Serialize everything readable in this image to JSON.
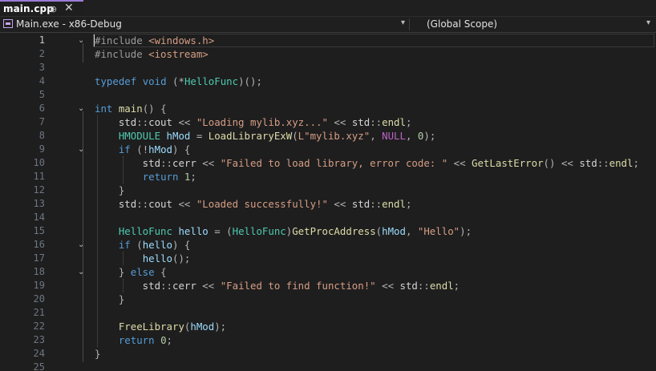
{
  "tab": {
    "title": "main.cpp",
    "pin_glyph": "⊕",
    "close_glyph": "✕"
  },
  "navbar": {
    "project": "Main.exe - x86-Debug",
    "scope": "(Global Scope)",
    "dropdown_glyph": "▾"
  },
  "editor": {
    "active_line": 1,
    "fold_glyph": "⌄",
    "lines": [
      {
        "n": "1",
        "fold": true,
        "tokens": [
          [
            "pp",
            "#include "
          ],
          [
            "st",
            "<windows.h>"
          ]
        ]
      },
      {
        "n": "2",
        "tokens": [
          [
            "pp",
            "#include "
          ],
          [
            "st",
            "<iostream>"
          ]
        ]
      },
      {
        "n": "3",
        "tokens": []
      },
      {
        "n": "4",
        "tokens": [
          [
            "kw",
            "typedef "
          ],
          [
            "kw",
            "void "
          ],
          [
            "op",
            "("
          ],
          [
            "op",
            "*"
          ],
          [
            "ty",
            "HelloFunc"
          ],
          [
            "op",
            ")();"
          ]
        ]
      },
      {
        "n": "5",
        "tokens": []
      },
      {
        "n": "6",
        "fold": true,
        "tokens": [
          [
            "kw",
            "int "
          ],
          [
            "fn",
            "main"
          ],
          [
            "op",
            "() {"
          ]
        ]
      },
      {
        "n": "7",
        "tokens": [
          [
            "pl",
            "    std"
          ],
          [
            "op",
            "::"
          ],
          [
            "pl",
            "cout "
          ],
          [
            "op",
            "<< "
          ],
          [
            "st",
            "\"Loading mylib.xyz...\" "
          ],
          [
            "op",
            "<< "
          ],
          [
            "pl",
            "std"
          ],
          [
            "op",
            "::"
          ],
          [
            "fn",
            "endl"
          ],
          [
            "op",
            ";"
          ]
        ]
      },
      {
        "n": "8",
        "tokens": [
          [
            "pl",
            "    "
          ],
          [
            "ty",
            "HMODULE "
          ],
          [
            "va",
            "hMod "
          ],
          [
            "op",
            "= "
          ],
          [
            "fn",
            "LoadLibraryExW"
          ],
          [
            "op",
            "("
          ],
          [
            "st",
            "L\"mylib.xyz\""
          ],
          [
            "op",
            ", "
          ],
          [
            "mc",
            "NULL"
          ],
          [
            "op",
            ", "
          ],
          [
            "nm",
            "0"
          ],
          [
            "op",
            ");"
          ]
        ]
      },
      {
        "n": "9",
        "fold": true,
        "tokens": [
          [
            "pl",
            "    "
          ],
          [
            "kw",
            "if "
          ],
          [
            "op",
            "(!"
          ],
          [
            "va",
            "hMod"
          ],
          [
            "op",
            ") {"
          ]
        ]
      },
      {
        "n": "10",
        "tokens": [
          [
            "pl",
            "        std"
          ],
          [
            "op",
            "::"
          ],
          [
            "pl",
            "cerr "
          ],
          [
            "op",
            "<< "
          ],
          [
            "st",
            "\"Failed to load library, error code: \" "
          ],
          [
            "op",
            "<< "
          ],
          [
            "fn",
            "GetLastError"
          ],
          [
            "op",
            "() << "
          ],
          [
            "pl",
            "std"
          ],
          [
            "op",
            "::"
          ],
          [
            "fn",
            "endl"
          ],
          [
            "op",
            ";"
          ]
        ]
      },
      {
        "n": "11",
        "tokens": [
          [
            "pl",
            "        "
          ],
          [
            "kw",
            "return "
          ],
          [
            "nm",
            "1"
          ],
          [
            "op",
            ";"
          ]
        ]
      },
      {
        "n": "12",
        "tokens": [
          [
            "op",
            "    }"
          ]
        ]
      },
      {
        "n": "13",
        "tokens": [
          [
            "pl",
            "    std"
          ],
          [
            "op",
            "::"
          ],
          [
            "pl",
            "cout "
          ],
          [
            "op",
            "<< "
          ],
          [
            "st",
            "\"Loaded successfully!\" "
          ],
          [
            "op",
            "<< "
          ],
          [
            "pl",
            "std"
          ],
          [
            "op",
            "::"
          ],
          [
            "fn",
            "endl"
          ],
          [
            "op",
            ";"
          ]
        ]
      },
      {
        "n": "14",
        "tokens": []
      },
      {
        "n": "15",
        "tokens": [
          [
            "pl",
            "    "
          ],
          [
            "ty",
            "HelloFunc "
          ],
          [
            "va",
            "hello "
          ],
          [
            "op",
            "= ("
          ],
          [
            "ty",
            "HelloFunc"
          ],
          [
            "op",
            ")"
          ],
          [
            "fn",
            "GetProcAddress"
          ],
          [
            "op",
            "("
          ],
          [
            "va",
            "hMod"
          ],
          [
            "op",
            ", "
          ],
          [
            "st",
            "\"Hello\""
          ],
          [
            "op",
            ");"
          ]
        ]
      },
      {
        "n": "16",
        "fold": true,
        "tokens": [
          [
            "pl",
            "    "
          ],
          [
            "kw",
            "if "
          ],
          [
            "op",
            "("
          ],
          [
            "va",
            "hello"
          ],
          [
            "op",
            ") {"
          ]
        ]
      },
      {
        "n": "17",
        "tokens": [
          [
            "pl",
            "        "
          ],
          [
            "va",
            "hello"
          ],
          [
            "op",
            "();"
          ]
        ]
      },
      {
        "n": "18",
        "fold": true,
        "tokens": [
          [
            "op",
            "    } "
          ],
          [
            "kw",
            "else "
          ],
          [
            "op",
            "{"
          ]
        ]
      },
      {
        "n": "19",
        "tokens": [
          [
            "pl",
            "        std"
          ],
          [
            "op",
            "::"
          ],
          [
            "pl",
            "cerr "
          ],
          [
            "op",
            "<< "
          ],
          [
            "st",
            "\"Failed to find function!\" "
          ],
          [
            "op",
            "<< "
          ],
          [
            "pl",
            "std"
          ],
          [
            "op",
            "::"
          ],
          [
            "fn",
            "endl"
          ],
          [
            "op",
            ";"
          ]
        ]
      },
      {
        "n": "20",
        "tokens": [
          [
            "op",
            "    }"
          ]
        ]
      },
      {
        "n": "21",
        "tokens": []
      },
      {
        "n": "22",
        "tokens": [
          [
            "pl",
            "    "
          ],
          [
            "fn",
            "FreeLibrary"
          ],
          [
            "op",
            "("
          ],
          [
            "va",
            "hMod"
          ],
          [
            "op",
            ");"
          ]
        ]
      },
      {
        "n": "23",
        "tokens": [
          [
            "pl",
            "    "
          ],
          [
            "kw",
            "return "
          ],
          [
            "nm",
            "0"
          ],
          [
            "op",
            ";"
          ]
        ]
      },
      {
        "n": "24",
        "tokens": [
          [
            "op",
            "}"
          ]
        ]
      },
      {
        "n": "25",
        "tokens": []
      }
    ]
  }
}
